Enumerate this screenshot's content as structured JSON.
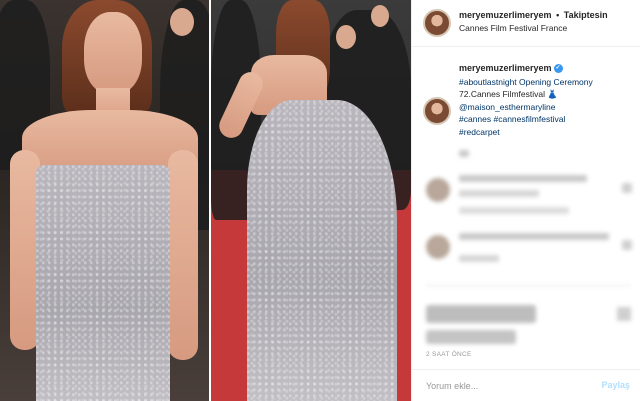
{
  "header": {
    "username": "meryemuzerlimeryem",
    "separator": "•",
    "follow_label": "Takiptesin",
    "location": "Cannes Film Festival France"
  },
  "caption": {
    "username": "meryemuzerlimeryem",
    "lines": [
      "#aboutlastnight Opening Ceremony",
      "72.Cannes Filmfestival",
      "@maison_esthermaryline",
      "#cannes #cannesfilmfestival",
      "#redcarpet"
    ],
    "dress_emoji": "👗"
  },
  "colors": {
    "link": "#003569",
    "verified": "#3897f0",
    "share_disabled": "#b2dffc"
  },
  "post": {
    "timestamp": "2 SAAT ÖNCE",
    "comment_placeholder": "Yorum ekle...",
    "share_label": "Paylaş"
  }
}
